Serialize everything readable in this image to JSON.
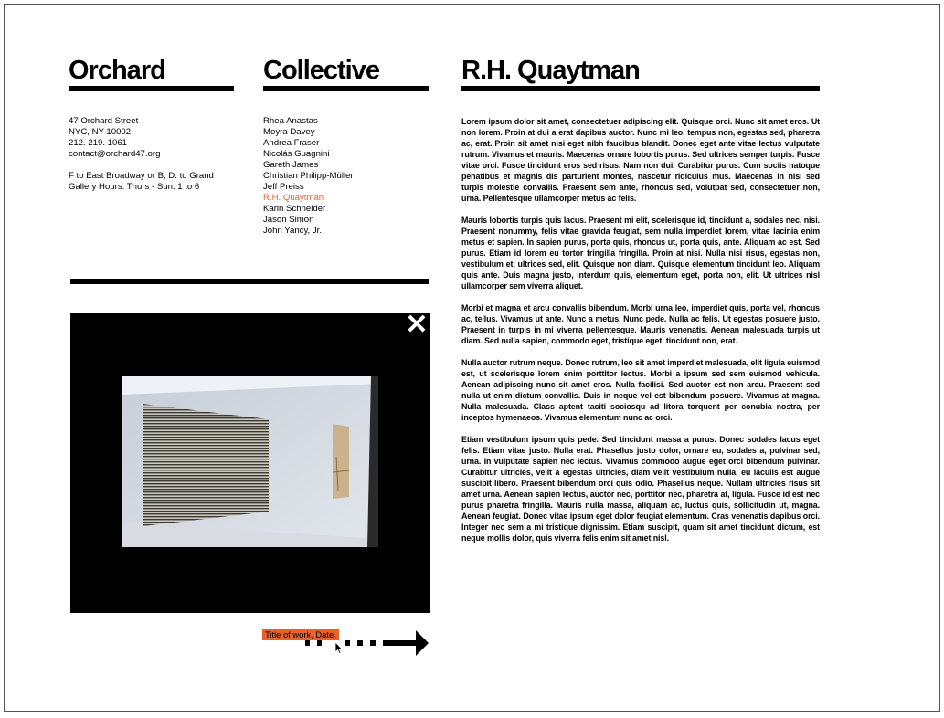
{
  "header": {
    "gallery_name": "Orchard",
    "collective_label": "Collective",
    "artist_name": "R.H. Quaytman"
  },
  "contact": {
    "street": "47 Orchard Street",
    "city": "NYC, NY 10002",
    "phone": "212. 219. 1061",
    "email": "contact@orchard47.org",
    "transit": "F to East Broadway or B, D. to Grand",
    "hours": "Gallery Hours: Thurs - Sun. 1 to 6"
  },
  "artists": [
    "Rhea Anastas",
    "Moyra Davey",
    "Andrea Fraser",
    "Nicolás Guagnini",
    "Gareth James",
    "Christian Philipp-Müller",
    "Jeff Preiss",
    "R.H. Quaytman",
    "Karin Schneider",
    "Jason Simon",
    "John Yancy, Jr."
  ],
  "active_artist": "R.H. Quaytman",
  "viewer": {
    "close_icon": "close-icon",
    "caption": "Title of work, Date."
  },
  "article": {
    "paragraphs": [
      "Lorem ipsum dolor sit amet, consectetuer adipiscing elit. Quisque orci. Nunc sit amet eros. Ut non lorem. Proin at dui a erat dapibus auctor. Nunc mi leo, tempus non, egestas sed, pharetra ac, erat. Proin sit amet nisi eget nibh faucibus blandit. Donec eget ante vitae lectus vulputate rutrum. Vivamus et mauris. Maecenas ornare lobortis purus. Sed ultrices semper turpis. Fusce vitae orci. Fusce tincidunt eros sed risus. Nam non dui. Curabitur purus. Cum sociis natoque penatibus et magnis dis parturient montes, nascetur ridiculus mus. Maecenas in nisi sed turpis molestie convallis. Praesent sem ante, rhoncus sed, volutpat sed, consectetuer non, urna. Pellentesque ullamcorper metus ac felis.",
      "Mauris lobortis turpis quis lacus. Praesent mi elit, scelerisque id, tincidunt a, sodales nec, nisi. Praesent nonummy, felis vitae gravida feugiat, sem nulla imperdiet lorem, vitae lacinia enim metus et sapien. In sapien purus, porta quis, rhoncus ut, porta quis, ante. Aliquam ac est. Sed purus. Etiam id lorem eu tortor fringilla fringilla. Proin at nisi. Nulla nisi risus, egestas non, vestibulum et, ultrices sed, elit. Quisque non diam. Quisque elementum tincidunt leo. Aliquam quis ante. Duis magna justo, interdum quis, elementum eget, porta non, elit. Ut ultrices nisl ullamcorper sem viverra aliquet.",
      "Morbi et magna et arcu convallis bibendum. Morbi urna leo, imperdiet quis, porta vel, rhoncus ac, tellus. Vivamus ut ante. Nunc a metus. Nunc pede. Nulla ac felis. Ut egestas posuere justo. Praesent in turpis in mi viverra pellentesque. Mauris venenatis. Aenean malesuada turpis ut diam. Sed nulla sapien, commodo eget, tristique eget, tincidunt non, erat.",
      "Nulla auctor rutrum neque. Donec rutrum, leo sit amet imperdiet malesuada, elit ligula euismod est, ut scelerisque lorem enim porttitor lectus. Morbi a ipsum sed sem euismod vehicula. Aenean adipiscing nunc sit amet eros. Nulla facilisi. Sed auctor est non arcu. Praesent sed nulla ut enim dictum convallis. Duis in neque vel est bibendum posuere. Vivamus at magna. Nulla malesuada. Class aptent taciti sociosqu ad litora torquent per conubia nostra, per inceptos hymenaeos. Vivamus elementum nunc ac orci.",
      "Etiam vestibulum ipsum quis pede. Sed tincidunt massa a purus. Donec sodales lacus eget felis. Etiam vitae justo. Nulla erat. Phasellus justo dolor, ornare eu, sodales a, pulvinar sed, urna. In vulputate sapien nec lectus. Vivamus commodo augue eget orci bibendum pulvinar. Curabitur ultricies, velit a egestas ultricies, diam velit vestibulum nulla, eu iaculis est augue suscipit libero. Praesent bibendum orci quis odio. Phasellus neque. Nullam ultricies risus sit amet urna. Aenean sapien lectus, auctor nec, porttitor nec, pharetra at, ligula. Fusce id est nec purus pharetra fringilla. Mauris nulla massa, aliquam ac, luctus quis, sollicitudin ut, magna. Aenean feugiat. Donec vitae ipsum eget dolor feugiat elementum. Cras venenatis dapibus orci. Integer nec sem a mi tristique dignissim. Etiam suscipit, quam sit amet tincidunt dictum, est neque mollis dolor, quis viverra felis enim sit amet nisl."
    ]
  },
  "colors": {
    "accent": "#e8632c",
    "text": "#000000",
    "background": "#ffffff"
  }
}
